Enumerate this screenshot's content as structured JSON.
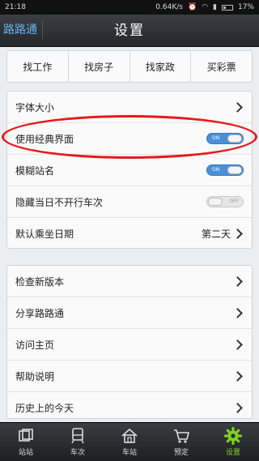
{
  "status_bar": {
    "time": "21:18",
    "speed": "0.64K/s",
    "battery": "17%"
  },
  "header": {
    "app_name": "路路通",
    "title": "设置"
  },
  "quick_links": [
    {
      "label": "找工作"
    },
    {
      "label": "找房子"
    },
    {
      "label": "找家政"
    },
    {
      "label": "买彩票"
    }
  ],
  "settings": {
    "font_size": "字体大小",
    "classic_ui": "使用经典界面",
    "classic_ui_state": "ON",
    "fuzzy_station": "模糊站名",
    "fuzzy_station_state": "ON",
    "hide_trains": "隐藏当日不开行车次",
    "hide_trains_state": "OFF",
    "default_date": "默认乘坐日期",
    "default_date_value": "第二天"
  },
  "more": [
    {
      "label": "检查新版本"
    },
    {
      "label": "分享路路通"
    },
    {
      "label": "访问主页"
    },
    {
      "label": "帮助说明"
    },
    {
      "label": "历史上的今天"
    }
  ],
  "tabs": [
    {
      "label": "站站",
      "icon": "station-to-station-icon"
    },
    {
      "label": "车次",
      "icon": "train-icon"
    },
    {
      "label": "车站",
      "icon": "station-house-icon"
    },
    {
      "label": "预定",
      "icon": "cart-icon"
    },
    {
      "label": "设置",
      "icon": "gear-icon",
      "active": true
    }
  ],
  "colors": {
    "accent": "#4a90d9",
    "highlight": "#e51a1a",
    "active_tab": "#7ed321"
  }
}
